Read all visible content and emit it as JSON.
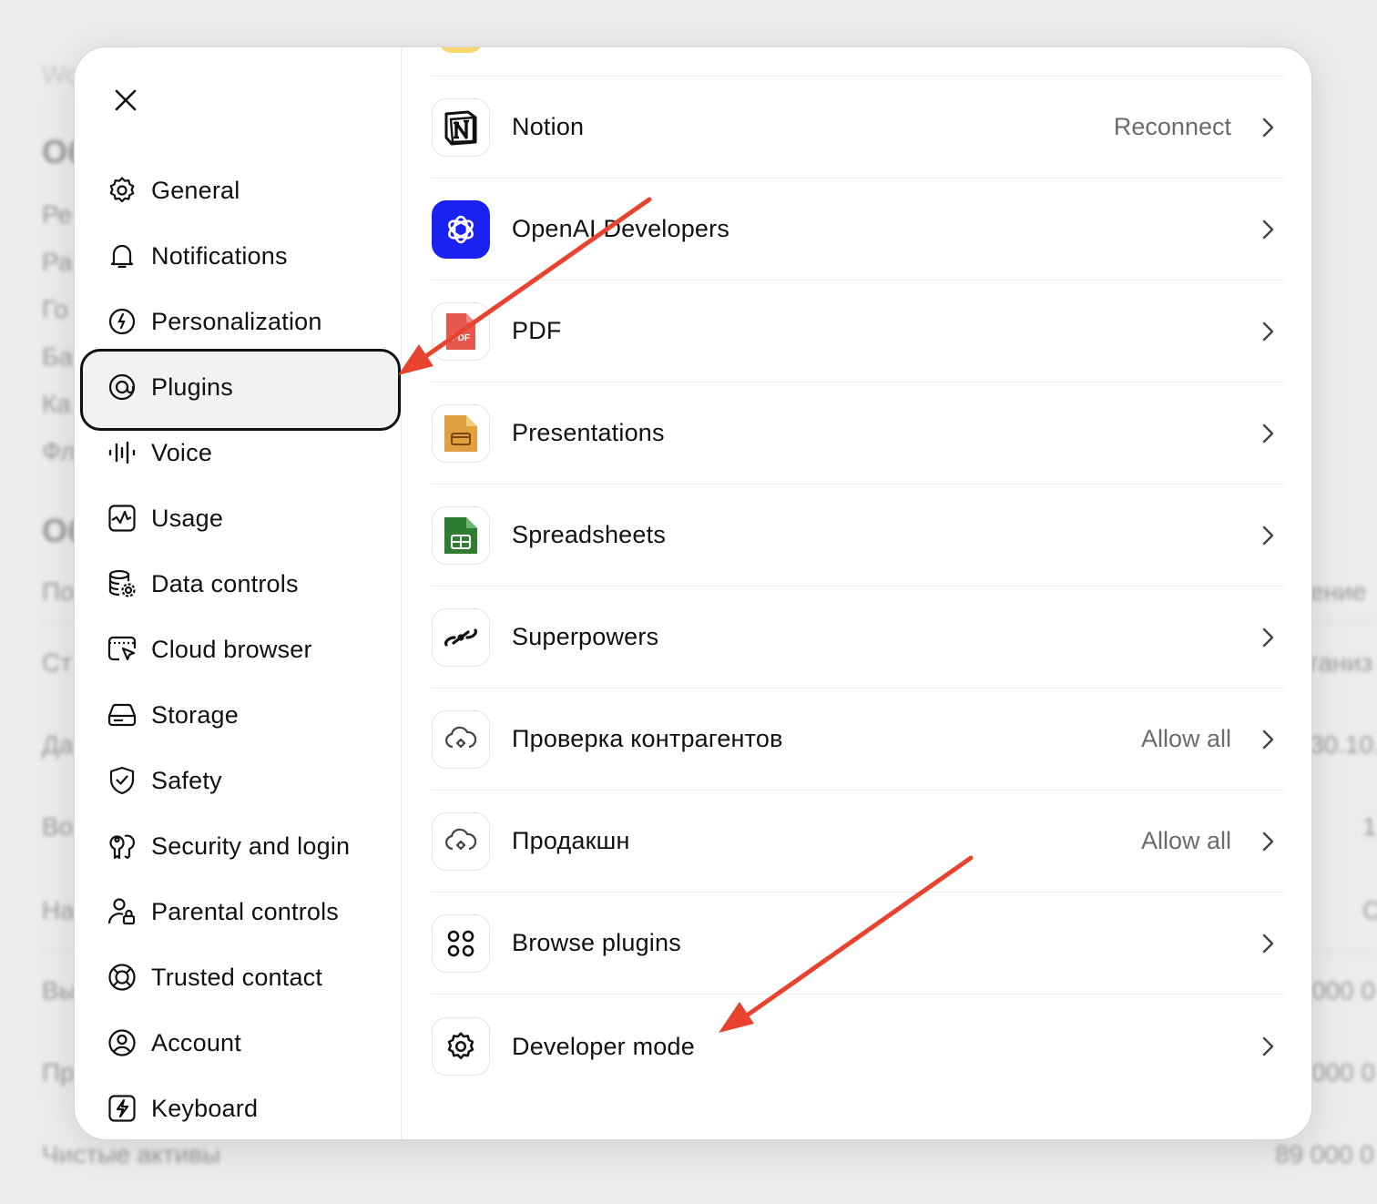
{
  "background": {
    "texts": [
      "Wo",
      "Об",
      "Ре",
      "Ра",
      "Го",
      "Ба",
      "Ка",
      "Фл",
      "Об",
      "По",
      "Ст",
      "Да",
      "Во",
      "На",
      "Вы",
      "Пр",
      "ение",
      "ганиз",
      "30.10.",
      "1",
      "С",
      "000 0",
      "000 0",
      "Чистые активы",
      "89 000 0"
    ]
  },
  "sidebar": {
    "close_label": "Close",
    "items": [
      {
        "label": "General",
        "icon": "gear-icon"
      },
      {
        "label": "Notifications",
        "icon": "bell-icon"
      },
      {
        "label": "Personalization",
        "icon": "personalization-icon"
      },
      {
        "label": "Plugins",
        "icon": "plugins-icon",
        "active": true
      },
      {
        "label": "Voice",
        "icon": "voice-waveform-icon"
      },
      {
        "label": "Usage",
        "icon": "usage-chart-icon"
      },
      {
        "label": "Data controls",
        "icon": "database-gear-icon"
      },
      {
        "label": "Cloud browser",
        "icon": "cloud-browser-icon"
      },
      {
        "label": "Storage",
        "icon": "storage-drive-icon"
      },
      {
        "label": "Safety",
        "icon": "shield-check-icon"
      },
      {
        "label": "Security and login",
        "icon": "key-lock-icon"
      },
      {
        "label": "Parental controls",
        "icon": "person-lock-icon"
      },
      {
        "label": "Trusted contact",
        "icon": "lifebuoy-icon"
      },
      {
        "label": "Account",
        "icon": "account-icon"
      },
      {
        "label": "Keyboard",
        "icon": "keyboard-bolt-icon"
      }
    ]
  },
  "plugins": [
    {
      "name": "Notion",
      "status": "Reconnect",
      "icon": "notion-logo-icon"
    },
    {
      "name": "OpenAI Developers",
      "status": "",
      "icon": "openai-logo-icon"
    },
    {
      "name": "PDF",
      "status": "",
      "icon": "pdf-file-icon"
    },
    {
      "name": "Presentations",
      "status": "",
      "icon": "presentations-icon"
    },
    {
      "name": "Spreadsheets",
      "status": "",
      "icon": "spreadsheets-icon"
    },
    {
      "name": "Superpowers",
      "status": "",
      "icon": "superpowers-icon"
    },
    {
      "name": "Проверка контрагентов",
      "status": "Allow all",
      "icon": "cloud-plugin-icon"
    },
    {
      "name": "Продакшн",
      "status": "Allow all",
      "icon": "cloud-plugin-icon"
    },
    {
      "name": "Browse plugins",
      "status": "",
      "icon": "grid-circles-icon"
    },
    {
      "name": "Developer mode",
      "status": "",
      "icon": "gear-icon"
    }
  ],
  "colors": {
    "arrow": "#e8432f",
    "openai_bg": "#1a22f0",
    "pdf": "#e5584f",
    "presentations": "#e0a040",
    "spreadsheets": "#2f7d32"
  }
}
